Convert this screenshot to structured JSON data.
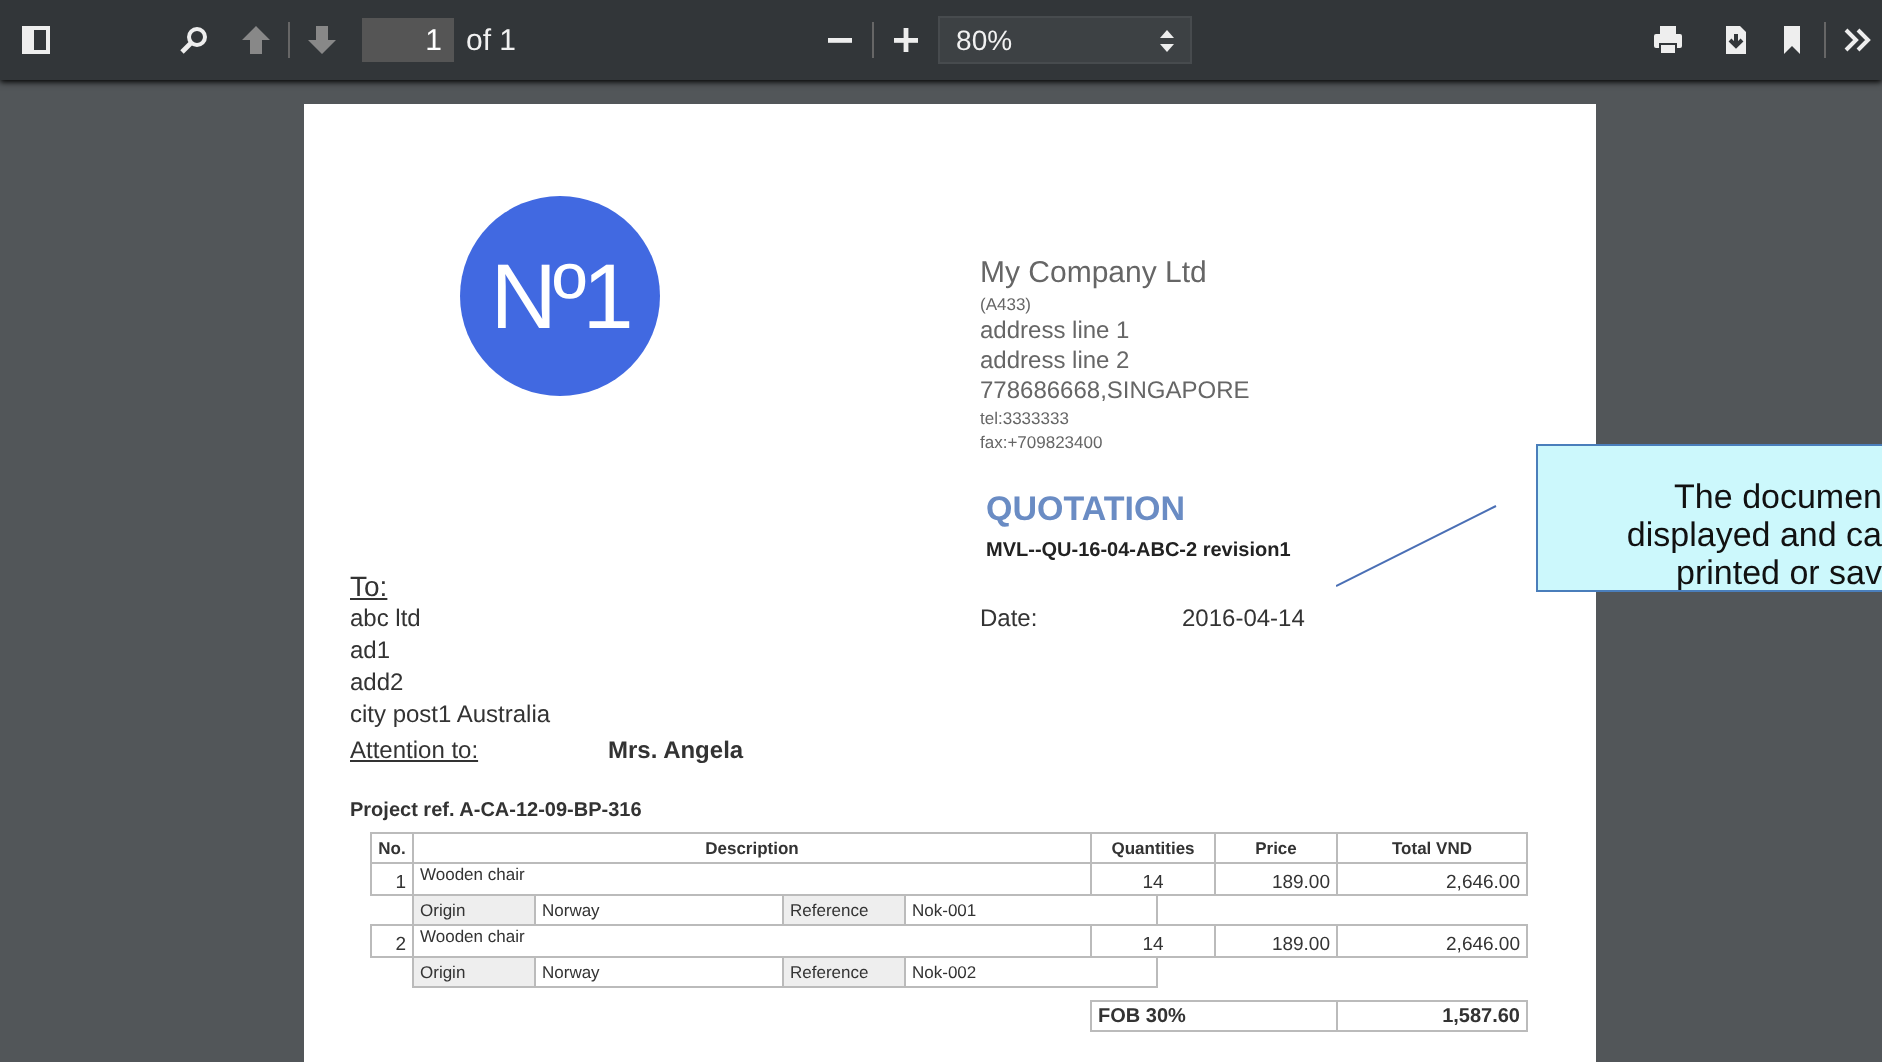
{
  "toolbar": {
    "page_number": "1",
    "page_count": "of 1",
    "zoom": "80%"
  },
  "document": {
    "logo": {
      "text": "Nº1"
    },
    "company": {
      "name": "My Company Ltd",
      "code": "(A433)",
      "address_lines": [
        "address line 1",
        "address line 2",
        "778686668,SINGAPORE"
      ],
      "tel": "tel:3333333",
      "fax": "fax:+709823400"
    },
    "title": "QUOTATION",
    "reference": "MVL--QU-16-04-ABC-2 revision1",
    "to_label": "To:",
    "recipient_lines": [
      "abc ltd",
      "ad1",
      "add2",
      "city post1 Australia"
    ],
    "date_label": "Date:",
    "date": "2016-04-14",
    "attention_label": "Attention to:",
    "attention": "Mrs. Angela",
    "project_ref": "Project ref. A-CA-12-09-BP-316",
    "table": {
      "columns": [
        "No.",
        "Description",
        "Quantities",
        "Price",
        "Total VND"
      ],
      "rows": [
        {
          "no": "1",
          "description": "Wooden chair",
          "quantity": "14",
          "price": "189.00",
          "total": "2,646.00",
          "details": [
            "Origin",
            "Norway",
            "Reference",
            "Nok-001"
          ]
        },
        {
          "no": "2",
          "description": "Wooden chair",
          "quantity": "14",
          "price": "189.00",
          "total": "2,646.00",
          "details": [
            "Origin",
            "Norway",
            "Reference",
            "Nok-002"
          ]
        }
      ]
    },
    "totals": [
      {
        "label": "FOB 30%",
        "value": "1,587.60"
      }
    ]
  },
  "callout": {
    "lines": [
      "The documen",
      "displayed and ca",
      "printed or sav"
    ]
  }
}
